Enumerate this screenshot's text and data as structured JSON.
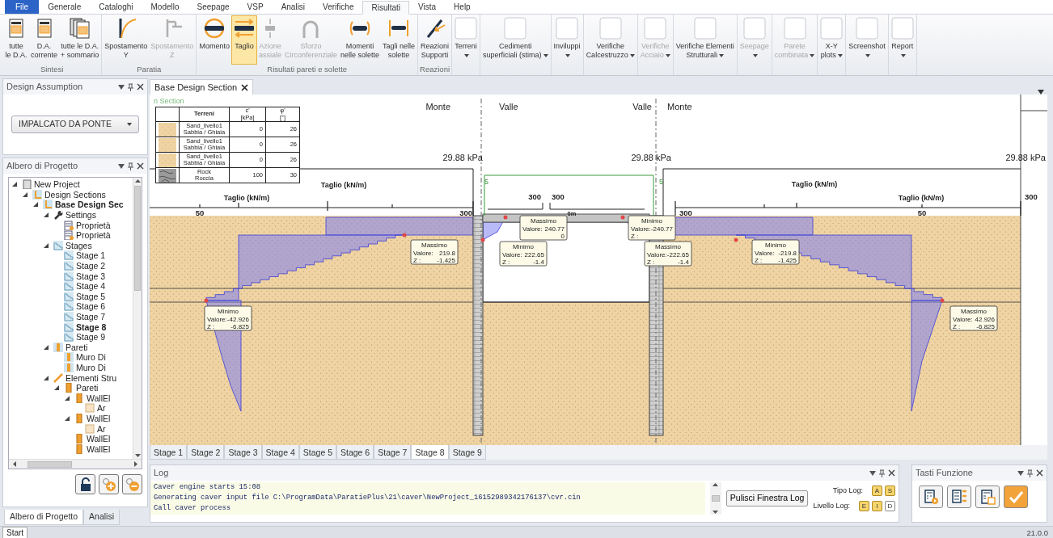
{
  "ribbon": {
    "tabs": [
      {
        "label": "File",
        "kind": "file",
        "selected": false
      },
      {
        "label": "Generale",
        "kind": "tab",
        "selected": false
      },
      {
        "label": "Cataloghi",
        "kind": "tab",
        "selected": false
      },
      {
        "label": "Modello",
        "kind": "tab",
        "selected": false
      },
      {
        "label": "Seepage",
        "kind": "tab",
        "selected": false
      },
      {
        "label": "VSP",
        "kind": "tab",
        "selected": false
      },
      {
        "label": "Analisi",
        "kind": "tab",
        "selected": false
      },
      {
        "label": "Verifiche",
        "kind": "tab",
        "selected": false
      },
      {
        "label": "Risultati",
        "kind": "tab",
        "selected": true
      },
      {
        "label": "Vista",
        "kind": "tab",
        "selected": false
      },
      {
        "label": "Help",
        "kind": "tab",
        "selected": false
      }
    ],
    "groups": [
      {
        "label": "Sintesi",
        "buttons": [
          {
            "lines": [
              "tutte",
              "le D.A."
            ],
            "disabled": false,
            "selected": false,
            "dropdown": false
          },
          {
            "lines": [
              "D.A.",
              "corrente"
            ],
            "disabled": false,
            "selected": false,
            "dropdown": false
          },
          {
            "lines": [
              "tutte le D.A.",
              "+ sommario"
            ],
            "disabled": false,
            "selected": false,
            "dropdown": false
          }
        ]
      },
      {
        "label": "Paratia",
        "buttons": [
          {
            "lines": [
              "Spostamento",
              "Y"
            ],
            "disabled": false,
            "selected": false,
            "dropdown": false
          },
          {
            "lines": [
              "Spostamento",
              "Z"
            ],
            "disabled": true,
            "selected": false,
            "dropdown": false
          }
        ]
      },
      {
        "label": "Risultati pareti e solette",
        "buttons": [
          {
            "lines": [
              "Momento"
            ],
            "disabled": false,
            "selected": false,
            "dropdown": false
          },
          {
            "lines": [
              "Taglio"
            ],
            "disabled": false,
            "selected": true,
            "dropdown": false
          },
          {
            "lines": [
              "Azione",
              "assiale"
            ],
            "disabled": true,
            "selected": false,
            "dropdown": false
          },
          {
            "lines": [
              "Sforzo",
              "Circonferenziale"
            ],
            "disabled": true,
            "selected": false,
            "dropdown": false
          },
          {
            "lines": [
              "Momenti",
              "nelle solette"
            ],
            "disabled": false,
            "selected": false,
            "dropdown": false
          },
          {
            "lines": [
              "Tagli nelle",
              "solette"
            ],
            "disabled": false,
            "selected": false,
            "dropdown": false
          }
        ]
      },
      {
        "label": "Reazioni",
        "buttons": [
          {
            "lines": [
              "Reazioni",
              "Supporti"
            ],
            "disabled": false,
            "selected": false,
            "dropdown": false
          }
        ]
      },
      {
        "buttons": [
          {
            "lines": [
              "Terreni"
            ],
            "disabled": false,
            "selected": false,
            "dropdown": true
          }
        ]
      },
      {
        "buttons": [
          {
            "lines": [
              "Cedimenti",
              "superficiali (stima)"
            ],
            "disabled": false,
            "selected": false,
            "dropdown": true
          }
        ]
      },
      {
        "buttons": [
          {
            "lines": [
              "Inviluppi"
            ],
            "disabled": false,
            "selected": false,
            "dropdown": true
          }
        ]
      },
      {
        "buttons": [
          {
            "lines": [
              "Verifiche",
              "Calcestruzzo"
            ],
            "disabled": false,
            "selected": false,
            "dropdown": true
          }
        ]
      },
      {
        "buttons": [
          {
            "lines": [
              "Verifiche",
              "Acciaio"
            ],
            "disabled": true,
            "selected": false,
            "dropdown": true
          }
        ]
      },
      {
        "buttons": [
          {
            "lines": [
              "Verifiche Elementi",
              "Strutturali"
            ],
            "disabled": false,
            "selected": false,
            "dropdown": true
          }
        ]
      },
      {
        "buttons": [
          {
            "lines": [
              "Seepage"
            ],
            "disabled": true,
            "selected": false,
            "dropdown": true
          }
        ]
      },
      {
        "buttons": [
          {
            "lines": [
              "Parete",
              "combinata"
            ],
            "disabled": true,
            "selected": false,
            "dropdown": true
          }
        ]
      },
      {
        "buttons": [
          {
            "lines": [
              "X-Y",
              "plots"
            ],
            "disabled": false,
            "selected": false,
            "dropdown": true
          }
        ]
      },
      {
        "buttons": [
          {
            "lines": [
              "Screenshot"
            ],
            "disabled": false,
            "selected": false,
            "dropdown": true
          }
        ]
      },
      {
        "buttons": [
          {
            "lines": [
              "Report"
            ],
            "disabled": false,
            "selected": false,
            "dropdown": true
          }
        ]
      }
    ]
  },
  "design_assumption": {
    "title": "Design Assumption",
    "value": "IMPALCATO DA PONTE"
  },
  "project_tree": {
    "title": "Albero di Progetto",
    "items": [
      {
        "label": "New Project",
        "kind": "project",
        "bold": false,
        "children": [
          {
            "label": "Design Sections",
            "kind": "sections",
            "bold": false,
            "children": [
              {
                "label": "Base Design Sec",
                "kind": "sections",
                "bold": true,
                "children": [
                  {
                    "label": "Settings",
                    "kind": "settings",
                    "bold": false,
                    "children": [
                      {
                        "label": "Proprietà",
                        "kind": "properties",
                        "bold": false
                      },
                      {
                        "label": "Proprietà",
                        "kind": "properties",
                        "bold": false
                      }
                    ]
                  },
                  {
                    "label": "Stages",
                    "kind": "stages",
                    "bold": false,
                    "children": [
                      {
                        "label": "Stage 1",
                        "kind": "stages",
                        "bold": false
                      },
                      {
                        "label": "Stage 2",
                        "kind": "stages",
                        "bold": false
                      },
                      {
                        "label": "Stage 3",
                        "kind": "stages",
                        "bold": false
                      },
                      {
                        "label": "Stage 4",
                        "kind": "stages",
                        "bold": false
                      },
                      {
                        "label": "Stage 5",
                        "kind": "stages",
                        "bold": false
                      },
                      {
                        "label": "Stage 6",
                        "kind": "stages",
                        "bold": false
                      },
                      {
                        "label": "Stage 7",
                        "kind": "stages",
                        "bold": false
                      },
                      {
                        "label": "Stage 8",
                        "kind": "stages",
                        "bold": true
                      },
                      {
                        "label": "Stage 9",
                        "kind": "stages",
                        "bold": false
                      }
                    ]
                  },
                  {
                    "label": "Pareti",
                    "kind": "walls",
                    "bold": false,
                    "children": [
                      {
                        "label": "Muro Di",
                        "kind": "walls",
                        "bold": false
                      },
                      {
                        "label": "Muro Di",
                        "kind": "walls",
                        "bold": false
                      }
                    ]
                  },
                  {
                    "label": "Elementi Stru",
                    "kind": "elements",
                    "bold": false,
                    "children": [
                      {
                        "label": "Pareti",
                        "kind": "wall",
                        "bold": false,
                        "children": [
                          {
                            "label": "WallEl",
                            "kind": "wall",
                            "bold": false,
                            "children": [
                              {
                                "label": "Ar",
                                "kind": "area",
                                "bold": false
                              }
                            ]
                          },
                          {
                            "label": "WallEl",
                            "kind": "wall",
                            "bold": false,
                            "children": [
                              {
                                "label": "Ar",
                                "kind": "area",
                                "bold": false
                              }
                            ]
                          },
                          {
                            "label": "WallEl",
                            "kind": "wall",
                            "bold": false
                          },
                          {
                            "label": "WallEl",
                            "kind": "wall",
                            "bold": false
                          }
                        ]
                      }
                    ]
                  }
                ]
              }
            ]
          }
        ]
      }
    ]
  },
  "left_tabs": [
    {
      "label": "Albero di Progetto",
      "selected": true
    },
    {
      "label": "Analisi",
      "selected": false
    }
  ],
  "document": {
    "tab": "Base Design Section",
    "canvas": {
      "watermark": "n Section",
      "legend": {
        "columns": [
          {
            "lines": [
              "Terreni"
            ]
          },
          {
            "lines": [
              "c'",
              "[kPa]"
            ]
          },
          {
            "lines": [
              "φ'",
              "[°]"
            ]
          }
        ],
        "rows": [
          {
            "kind": "sand",
            "name": [
              "Sand_livello1",
              "Sabbia / Ghiaia"
            ],
            "c": "0",
            "phi": "26"
          },
          {
            "kind": "sand",
            "name": [
              "Sand_livello1",
              "Sabbia / Ghiaia"
            ],
            "c": "0",
            "phi": "26"
          },
          {
            "kind": "sand",
            "name": [
              "Sand_livello1",
              "Sabbia / Ghiaia"
            ],
            "c": "0",
            "phi": "26"
          },
          {
            "kind": "rock",
            "name": [
              "Rock",
              "Roccia"
            ],
            "c": "100",
            "phi": "30"
          }
        ]
      },
      "side_labels": [
        "Monte",
        "Valle",
        "Valle",
        "Monte"
      ],
      "pressures": [
        "29.88 kPa",
        "29.88 kPa",
        "29.88 kPa"
      ],
      "axis_titles": [
        "Taglio (kN/m)",
        "Taglio (kN/m)",
        "Taglio (kN/m)",
        "Taglio (kN/m)"
      ],
      "scale_labels": [
        "50",
        "300",
        "300",
        "300",
        "0m",
        "300",
        "50",
        "300"
      ],
      "load_marks": [
        "5",
        "5"
      ],
      "callouts": [
        {
          "title": "Massimo",
          "rows": [
            {
              "label": "Valore:",
              "value": "219.8"
            },
            {
              "label": "Z :",
              "value": "-1.425"
            }
          ]
        },
        {
          "title": "Minimo",
          "rows": [
            {
              "label": "Valore:",
              "value": "-42.926"
            },
            {
              "label": "Z :",
              "value": "-6.825"
            }
          ]
        },
        {
          "title": "Massimo",
          "rows": [
            {
              "label": "Valore:",
              "value": "240.77"
            },
            {
              "value": "0"
            }
          ]
        },
        {
          "title": "Minimo",
          "rows": [
            {
              "label": "Valore:",
              "value": "222.65"
            },
            {
              "label": "Z :",
              "value": "-1.4"
            }
          ]
        },
        {
          "title": "Minimo",
          "rows": [
            {
              "label": "Valore:",
              "value": "-240.77"
            },
            {
              "label": "Z :"
            }
          ]
        },
        {
          "title": "Massimo",
          "rows": [
            {
              "label": "Valore:",
              "value": "-222.65"
            },
            {
              "label": "Z :",
              "value": "-1.4"
            }
          ]
        },
        {
          "title": "Minimo",
          "rows": [
            {
              "label": "Valore:",
              "value": "-219.8"
            },
            {
              "label": "Z :",
              "value": "-1.425"
            }
          ]
        },
        {
          "title": "Massimo",
          "rows": [
            {
              "label": "Valore:",
              "value": "42.926"
            },
            {
              "label": "Z :",
              "value": "-6.825"
            }
          ]
        }
      ]
    },
    "stage_tabs": [
      {
        "label": "Stage 1",
        "selected": false
      },
      {
        "label": "Stage 2",
        "selected": false
      },
      {
        "label": "Stage 3",
        "selected": false
      },
      {
        "label": "Stage 4",
        "selected": false
      },
      {
        "label": "Stage 5",
        "selected": false
      },
      {
        "label": "Stage 6",
        "selected": false
      },
      {
        "label": "Stage 7",
        "selected": false
      },
      {
        "label": "Stage 8",
        "selected": true
      },
      {
        "label": "Stage 9",
        "selected": false
      }
    ]
  },
  "log": {
    "title": "Log",
    "lines": [
      "Caver engine starts 15:08",
      "Generating caver input file C:\\ProgramData\\ParatiePlus\\21\\caver\\NewProject_16152989342176137\\cvr.cin",
      "Call caver process"
    ],
    "clear_button": "Pulisci Finestra Log",
    "type_label": "Tipo Log:",
    "type_buttons": [
      {
        "label": "A",
        "on": true
      },
      {
        "label": "S",
        "on": true
      }
    ],
    "level_label": "Livello Log:",
    "level_buttons": [
      {
        "label": "E",
        "on": true
      },
      {
        "label": "I",
        "on": true
      },
      {
        "label": "D",
        "on": false
      }
    ]
  },
  "function_keys": {
    "title": "Tasti Funzione",
    "buttons": [
      {
        "kind": "calc-run"
      },
      {
        "kind": "calc-list"
      },
      {
        "kind": "calc-sheet"
      },
      {
        "kind": "confirm"
      }
    ]
  },
  "status_bar": {
    "tab": "Start",
    "version": "21.0.0"
  }
}
